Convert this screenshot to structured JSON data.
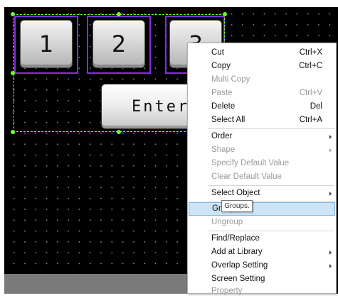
{
  "canvas": {
    "buttons": [
      {
        "label": "1"
      },
      {
        "label": "2"
      },
      {
        "label": "3"
      }
    ],
    "enter_button": {
      "label": "Enter"
    },
    "colors": {
      "selection": "#8a2be2",
      "group_selection": "#6cff2a",
      "background": "#000000"
    }
  },
  "context_menu": {
    "items": [
      {
        "label": "Cut",
        "shortcut": "Ctrl+X",
        "enabled": true
      },
      {
        "label": "Copy",
        "shortcut": "Ctrl+C",
        "enabled": true
      },
      {
        "label": "Multi Copy",
        "shortcut": "",
        "enabled": false
      },
      {
        "label": "Paste",
        "shortcut": "Ctrl+V",
        "enabled": false
      },
      {
        "label": "Delete",
        "shortcut": "Del",
        "enabled": true
      },
      {
        "label": "Select All",
        "shortcut": "Ctrl+A",
        "enabled": true
      },
      {
        "label": "Order",
        "submenu": true,
        "enabled": true
      },
      {
        "label": "Shape",
        "submenu": true,
        "enabled": false
      },
      {
        "label": "Specify Default Value",
        "enabled": false
      },
      {
        "label": "Clear Default Value",
        "enabled": false
      },
      {
        "label": "Select Object",
        "submenu": true,
        "enabled": true
      },
      {
        "label": "Group",
        "enabled": true,
        "highlighted": true
      },
      {
        "label": "Ungroup",
        "enabled": false
      },
      {
        "label": "Find/Replace",
        "enabled": true
      },
      {
        "label": "Add at Library",
        "submenu": true,
        "enabled": true
      },
      {
        "label": "Overlap Setting",
        "submenu": true,
        "enabled": true
      },
      {
        "label": "Screen Setting",
        "enabled": true
      },
      {
        "label": "Property",
        "enabled": false
      }
    ],
    "highlight_color": "#cde4f7"
  },
  "tooltip": {
    "text": "Groups."
  }
}
